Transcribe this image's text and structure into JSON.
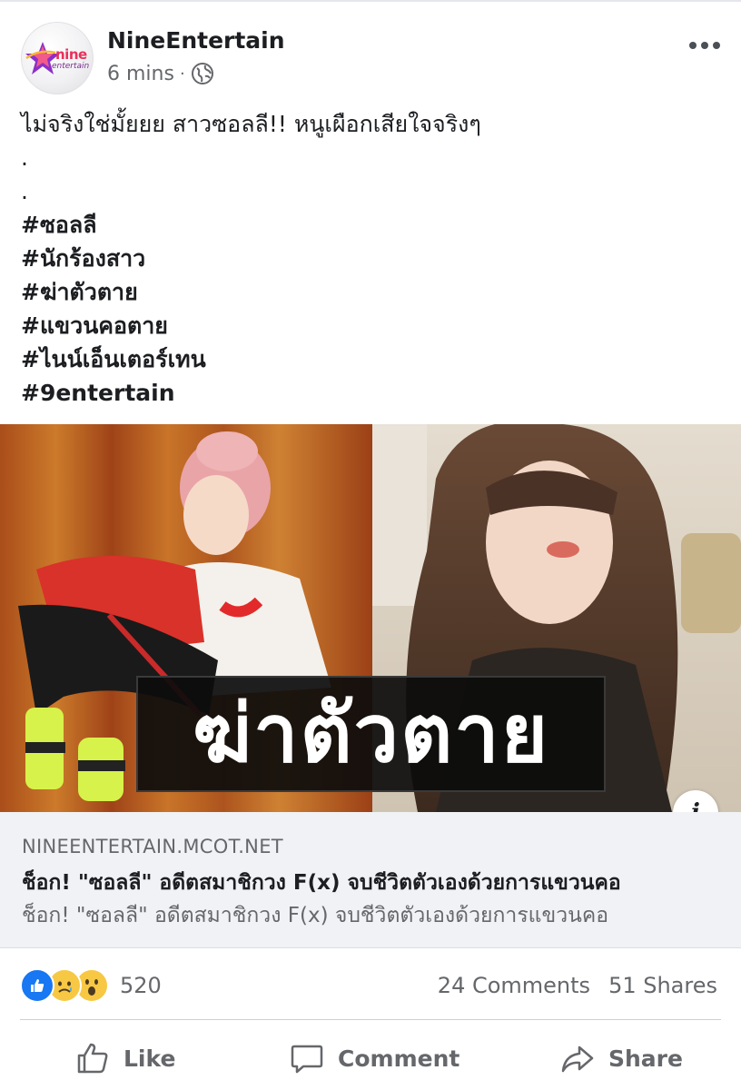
{
  "post": {
    "page_name": "NineEntertain",
    "time": "6 mins",
    "separator": "·",
    "privacy_icon": "globe-icon",
    "avatar_logo_top": "nine",
    "avatar_logo_bottom": "entertain",
    "caption_lines": [
      "ไม่จริงใช่มั้ยยย สาวซอลลี!! หนูเผือกเสียใจจริงๆ",
      ".",
      "."
    ],
    "hashtags": [
      "#ซอลลี",
      "#นักร้องสาว",
      "#ฆ่าตัวตาย",
      "#แขวนคอตาย",
      "#ไนน์เอ็นเตอร์เทน",
      "#9entertain"
    ],
    "image_overlay_text": "ฆ่าตัวตาย",
    "info_button_label": "i"
  },
  "link": {
    "domain": "NINEENTERTAIN.MCOT.NET",
    "title": "ช็อก! \"ซอลลี\" อดีตสมาชิกวง F(x) จบชีวิตตัวเองด้วยการแขวนคอ",
    "description": "ช็อก! \"ซอลลี\" อดีตสมาชิกวง F(x) จบชีวิตตัวเองด้วยการแขวนคอ"
  },
  "stats": {
    "reaction_icons": [
      "like-icon",
      "sad-icon",
      "wow-icon"
    ],
    "reaction_count": "520",
    "comments": "24 Comments",
    "shares": "51 Shares"
  },
  "actions": {
    "like": "Like",
    "comment": "Comment",
    "share": "Share"
  },
  "colors": {
    "brand_blue": "#1877f2",
    "text_primary": "#1c1e21",
    "text_secondary": "#65676b",
    "preview_bg": "#f0f2f5"
  }
}
